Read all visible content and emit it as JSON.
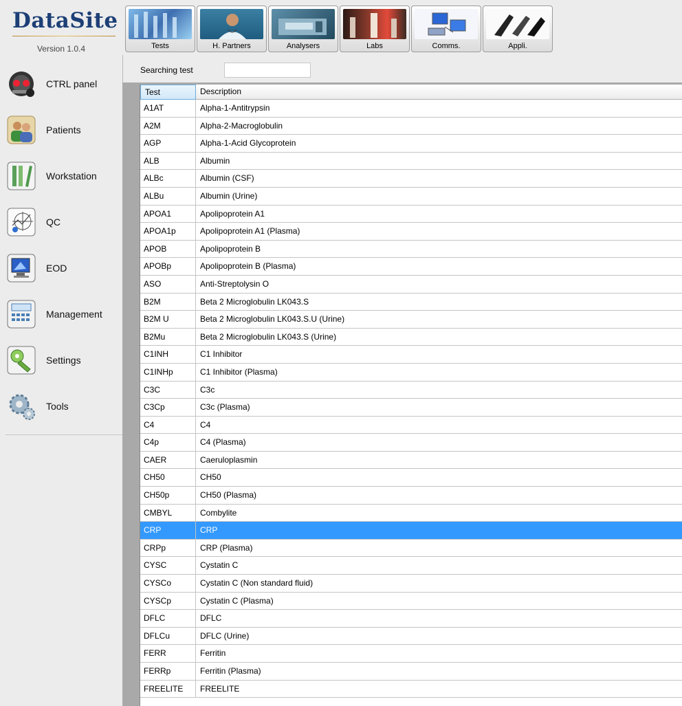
{
  "app": {
    "name": "DataSite",
    "version": "Version 1.0.4"
  },
  "sidebar": {
    "items": [
      {
        "label": "CTRL panel",
        "icon": "dashboard-icon"
      },
      {
        "label": "Patients",
        "icon": "patients-icon"
      },
      {
        "label": "Workstation",
        "icon": "workstation-icon"
      },
      {
        "label": "QC",
        "icon": "qc-chart-icon"
      },
      {
        "label": "EOD",
        "icon": "eod-monitor-icon"
      },
      {
        "label": "Management",
        "icon": "calculator-icon"
      },
      {
        "label": "Settings",
        "icon": "settings-icon"
      },
      {
        "label": "Tools",
        "icon": "gear-icon"
      }
    ]
  },
  "toolbar": {
    "buttons": [
      {
        "label": "Tests",
        "icon": "test-tubes-image"
      },
      {
        "label": "H. Partners",
        "icon": "doctor-image"
      },
      {
        "label": "Analysers",
        "icon": "analyser-image"
      },
      {
        "label": "Labs",
        "icon": "lab-image"
      },
      {
        "label": "Comms.",
        "icon": "network-image"
      },
      {
        "label": "Appli.",
        "icon": "application-image"
      }
    ]
  },
  "search": {
    "label": "Searching test",
    "value": ""
  },
  "grid": {
    "columns": [
      "Test",
      "Description"
    ],
    "selected_index": 25,
    "rows": [
      [
        "A1AT",
        "Alpha-1-Antitrypsin"
      ],
      [
        "A2M",
        "Alpha-2-Macroglobulin"
      ],
      [
        "AGP",
        "Alpha-1-Acid Glycoprotein"
      ],
      [
        "ALB",
        "Albumin"
      ],
      [
        "ALBc",
        "Albumin (CSF)"
      ],
      [
        "ALBu",
        "Albumin (Urine)"
      ],
      [
        "APOA1",
        "Apolipoprotein A1"
      ],
      [
        "APOA1p",
        "Apolipoprotein A1 (Plasma)"
      ],
      [
        "APOB",
        "Apolipoprotein B"
      ],
      [
        "APOBp",
        "Apolipoprotein B (Plasma)"
      ],
      [
        "ASO",
        "Anti-Streptolysin O"
      ],
      [
        "B2M",
        "Beta 2 Microglobulin LK043.S"
      ],
      [
        "B2M U",
        "Beta 2 Microglobulin LK043.S.U (Urine)"
      ],
      [
        "B2Mu",
        "Beta 2 Microglobulin LK043.S (Urine)"
      ],
      [
        "C1INH",
        "C1 Inhibitor"
      ],
      [
        "C1INHp",
        "C1 Inhibitor (Plasma)"
      ],
      [
        "C3C",
        "C3c"
      ],
      [
        "C3Cp",
        "C3c (Plasma)"
      ],
      [
        "C4",
        "C4"
      ],
      [
        "C4p",
        "C4 (Plasma)"
      ],
      [
        "CAER",
        "Caeruloplasmin"
      ],
      [
        "CH50",
        "CH50"
      ],
      [
        "CH50p",
        "CH50 (Plasma)"
      ],
      [
        "CMBYL",
        "Combylite"
      ],
      [
        "CRP",
        "CRP"
      ],
      [
        "CRPp",
        "CRP (Plasma)"
      ],
      [
        "CYSC",
        "Cystatin C"
      ],
      [
        "CYSCo",
        "Cystatin C (Non standard fluid)"
      ],
      [
        "CYSCp",
        "Cystatin C (Plasma)"
      ],
      [
        "DFLC",
        "DFLC"
      ],
      [
        "DFLCu",
        "DFLC (Urine)"
      ],
      [
        "FERR",
        "Ferritin"
      ],
      [
        "FERRp",
        "Ferritin (Plasma)"
      ],
      [
        "FREELITE",
        "FREELITE"
      ]
    ]
  },
  "colors": {
    "brand": "#1d3f76",
    "selection": "#3399ff",
    "panel": "#a9a9a9"
  }
}
